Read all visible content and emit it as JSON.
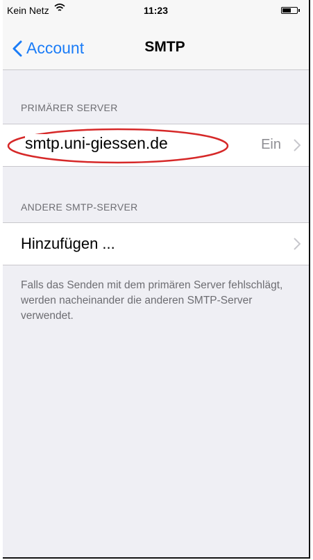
{
  "status_bar": {
    "carrier": "Kein Netz",
    "time": "11:23"
  },
  "nav": {
    "back_label": "Account",
    "title": "SMTP"
  },
  "primary_section": {
    "header": "PRIMÄRER SERVER",
    "server": "smtp.uni-giessen.de",
    "status": "Ein"
  },
  "other_section": {
    "header": "ANDERE SMTP-SERVER",
    "add_label": "Hinzufügen ..."
  },
  "footer_note": "Falls das Senden mit dem primären Server fehlschlägt, werden nacheinander die anderen SMTP-Server verwendet.",
  "colors": {
    "accent": "#1a7cf7",
    "highlight": "#d62828",
    "background": "#efeff4"
  },
  "icons": [
    "wifi-icon",
    "battery-icon",
    "back-chevron-icon",
    "chevron-right-icon"
  ]
}
